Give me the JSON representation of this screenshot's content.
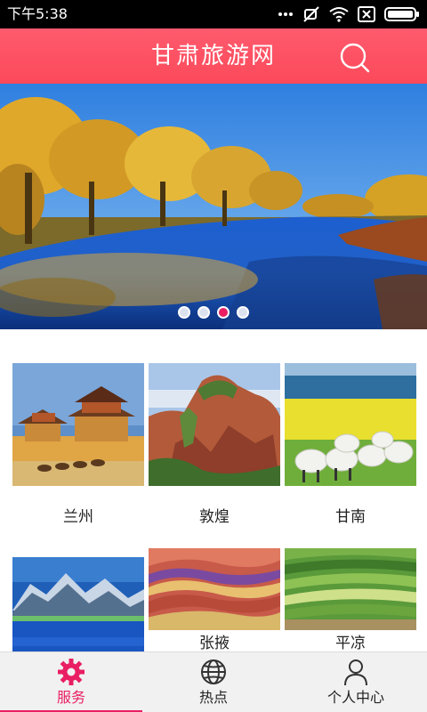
{
  "status_bar": {
    "time": "下午5:38",
    "icons": [
      "more-dots-icon",
      "mute-icon",
      "wifi-icon",
      "sim-icon",
      "battery-icon"
    ]
  },
  "header": {
    "title": "甘肃旅游网",
    "search_icon": "search-icon",
    "color": "#fb4a5a"
  },
  "banner": {
    "page_count": 4,
    "active_index": 2,
    "dot_active_color": "#e91e63"
  },
  "destinations": [
    {
      "label": "兰州"
    },
    {
      "label": "敦煌"
    },
    {
      "label": "甘南"
    },
    {
      "label": ""
    },
    {
      "label": "张掖"
    },
    {
      "label": "平凉"
    }
  ],
  "bottom_nav": {
    "items": [
      {
        "label": "服务",
        "icon": "gear-icon",
        "active": true
      },
      {
        "label": "热点",
        "icon": "globe-icon",
        "active": false
      },
      {
        "label": "个人中心",
        "icon": "person-icon",
        "active": false
      }
    ],
    "active_color": "#e91e63"
  }
}
